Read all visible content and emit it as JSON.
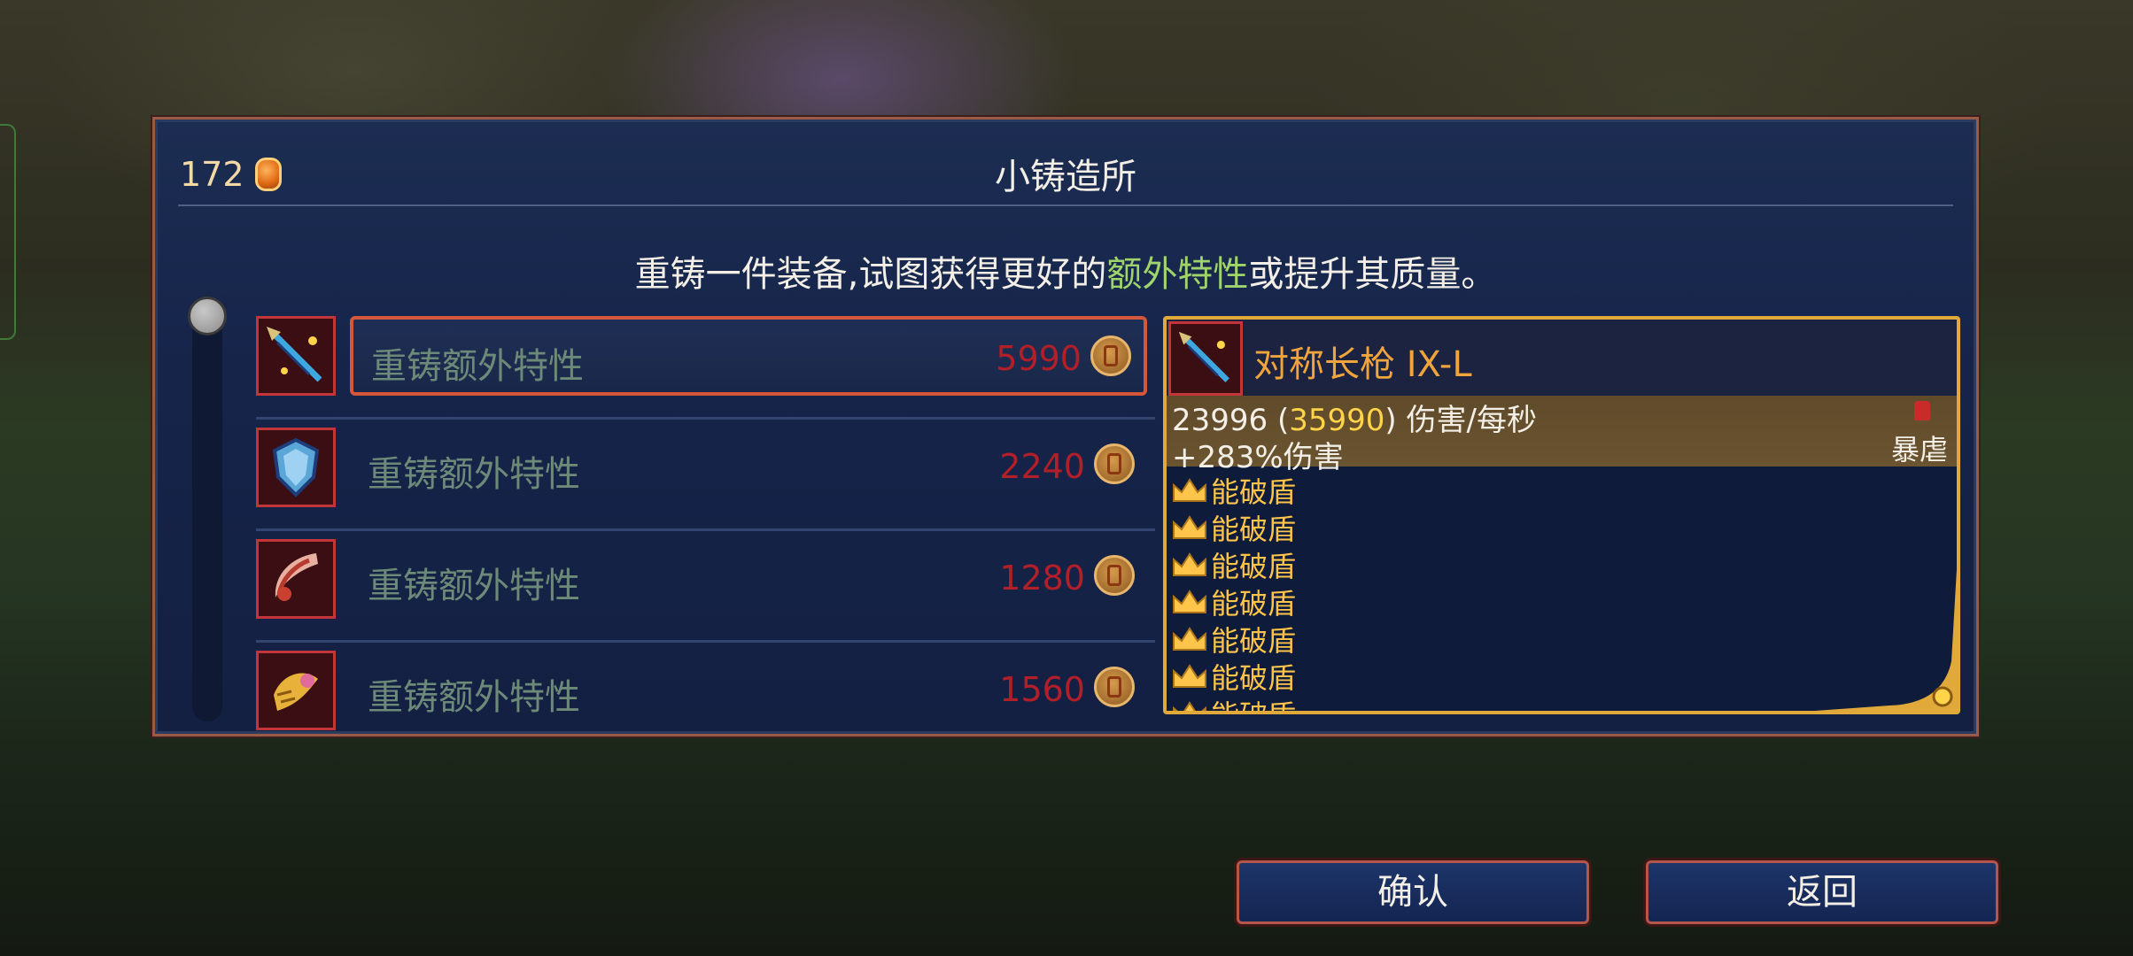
{
  "currency": {
    "amount": "172",
    "icon": "cell-coin-icon"
  },
  "title": "小铸造所",
  "subtitle": {
    "before": "重铸一件装备,试图获得更好的",
    "highlight": "额外特性",
    "after": "或提升其质量。"
  },
  "items": [
    {
      "icon": "spear-icon",
      "label": "重铸额外特性",
      "cost": "5990",
      "selected": true
    },
    {
      "icon": "shield-icon",
      "label": "重铸额外特性",
      "cost": "2240",
      "selected": false
    },
    {
      "icon": "claw-icon",
      "label": "重铸额外特性",
      "cost": "1280",
      "selected": false
    },
    {
      "icon": "golden-fish-icon",
      "label": "重铸额外特性",
      "cost": "1560",
      "selected": false
    }
  ],
  "detail": {
    "name": "对称长枪  IX-L",
    "dps_base": "23996",
    "dps_paren_open": " (",
    "dps_max": "35990",
    "dps_paren_close": ") 伤害/每秒",
    "damage_bonus": "+283%伤害",
    "scaling": "暴虐",
    "mods": [
      "能破盾",
      "能破盾",
      "能破盾",
      "能破盾",
      "能破盾",
      "能破盾",
      "能破盾"
    ]
  },
  "buttons": {
    "confirm": "确认",
    "back": "返回"
  },
  "colors": {
    "accent_gold": "#e0a93a",
    "cost_red": "#b21f29",
    "highlight_green": "#9fd36b",
    "brutality_red": "#c92b2b"
  }
}
